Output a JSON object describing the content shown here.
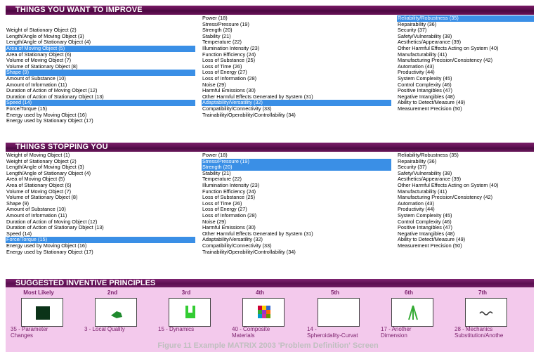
{
  "improve": {
    "title": "THINGS YOU WANT TO IMPROVE",
    "col1": [
      {
        "label": "",
        "sel": false
      },
      {
        "label": "",
        "sel": false
      },
      {
        "label": "Weight of Stationary Object (2)",
        "sel": false
      },
      {
        "label": "Length/Angle of Moving Object (3)",
        "sel": false
      },
      {
        "label": "Length/Angle of Stationary Object (4)",
        "sel": false
      },
      {
        "label": "Area of Moving Object (5)",
        "sel": true
      },
      {
        "label": "Area of Stationary Object (6)",
        "sel": false
      },
      {
        "label": "Volume of Moving Object (7)",
        "sel": false
      },
      {
        "label": "Volume of Stationary Object (8)",
        "sel": false
      },
      {
        "label": "Shape (9)",
        "sel": true
      },
      {
        "label": "Amount of Substance (10)",
        "sel": false
      },
      {
        "label": "Amount of Information (11)",
        "sel": false
      },
      {
        "label": "Duration of Action of Moving Object (12)",
        "sel": false
      },
      {
        "label": "Duration of Action of Stationary Object (13)",
        "sel": false
      },
      {
        "label": "Speed (14)",
        "sel": true
      },
      {
        "label": "Force/Torque (15)",
        "sel": false
      },
      {
        "label": "Energy used by Moving Object (16)",
        "sel": false
      },
      {
        "label": "Energy used by Stationary Object (17)",
        "sel": false
      }
    ],
    "col2": [
      {
        "label": "Power (18)",
        "sel": false
      },
      {
        "label": "Stress/Pressure (19)",
        "sel": false
      },
      {
        "label": "Strength (20)",
        "sel": false
      },
      {
        "label": "Stability (21)",
        "sel": false
      },
      {
        "label": "Temperature (22)",
        "sel": false
      },
      {
        "label": "Illumination Intensity (23)",
        "sel": false
      },
      {
        "label": "Function Efficiency (24)",
        "sel": false
      },
      {
        "label": "Loss of Substance (25)",
        "sel": false
      },
      {
        "label": "Loss of Time (26)",
        "sel": false
      },
      {
        "label": "Loss of Energy (27)",
        "sel": false
      },
      {
        "label": "Loss of Information (28)",
        "sel": false
      },
      {
        "label": "Noise (29)",
        "sel": false
      },
      {
        "label": "Harmful Emissions (30)",
        "sel": false
      },
      {
        "label": "Other Harmful Effects Generated by System (31)",
        "sel": false
      },
      {
        "label": "Adaptability/Versatility (32)",
        "sel": true
      },
      {
        "label": "Compatibility/Connectivity (33)",
        "sel": false
      },
      {
        "label": "Trainability/Operability/Controllability (34)",
        "sel": false
      }
    ],
    "col3": [
      {
        "label": "Reliability/Robustness (35)",
        "sel": true
      },
      {
        "label": "Repairability (36)",
        "sel": false
      },
      {
        "label": "Security (37)",
        "sel": false
      },
      {
        "label": "Safety/Vulnerability (38)",
        "sel": false
      },
      {
        "label": "Aesthetics/Appearance (39)",
        "sel": false
      },
      {
        "label": "Other Harmful Effects Acting on System (40)",
        "sel": false
      },
      {
        "label": "Manufacturability (41)",
        "sel": false
      },
      {
        "label": "Manufacturing Precision/Consistency (42)",
        "sel": false
      },
      {
        "label": "Automation (43)",
        "sel": false
      },
      {
        "label": "Productivity (44)",
        "sel": false
      },
      {
        "label": "System Complexity (45)",
        "sel": false
      },
      {
        "label": "Control Complexity (46)",
        "sel": false
      },
      {
        "label": "Positive Intangibles (47)",
        "sel": false
      },
      {
        "label": "Negative Intangibles (48)",
        "sel": false
      },
      {
        "label": "Ability to Detect/Measure (49)",
        "sel": false
      },
      {
        "label": "Measurement Precision (50)",
        "sel": false
      }
    ]
  },
  "stopping": {
    "title": "THINGS STOPPING YOU",
    "col1": [
      {
        "label": "Weight of Moving Object (1)",
        "sel": false
      },
      {
        "label": "Weight of Stationary Object (2)",
        "sel": false
      },
      {
        "label": "Length/Angle of Moving Object (3)",
        "sel": false
      },
      {
        "label": "Length/Angle of Stationary Object (4)",
        "sel": false
      },
      {
        "label": "Area of Moving Object (5)",
        "sel": false
      },
      {
        "label": "Area of Stationary Object (6)",
        "sel": false
      },
      {
        "label": "Volume of Moving Object (7)",
        "sel": false
      },
      {
        "label": "Volume of Stationary Object (8)",
        "sel": false
      },
      {
        "label": "Shape (9)",
        "sel": false
      },
      {
        "label": "Amount of Substance (10)",
        "sel": false
      },
      {
        "label": "Amount of Information (11)",
        "sel": false
      },
      {
        "label": "Duration of Action of Moving Object (12)",
        "sel": false
      },
      {
        "label": "Duration of Action of Stationary Object (13)",
        "sel": false
      },
      {
        "label": "Speed (14)",
        "sel": false
      },
      {
        "label": "Force/Torque (15)",
        "sel": true
      },
      {
        "label": "Energy used by Moving Object (16)",
        "sel": false
      },
      {
        "label": "Energy used by Stationary Object (17)",
        "sel": false
      }
    ],
    "col2": [
      {
        "label": "Power (18)",
        "sel": false
      },
      {
        "label": "Stress/Pressure (19)",
        "sel": true
      },
      {
        "label": "Strength (20)",
        "sel": true
      },
      {
        "label": "Stability (21)",
        "sel": false
      },
      {
        "label": "Temperature (22)",
        "sel": false
      },
      {
        "label": "Illumination Intensity (23)",
        "sel": false
      },
      {
        "label": "Function Efficiency (24)",
        "sel": false
      },
      {
        "label": "Loss of Substance (25)",
        "sel": false
      },
      {
        "label": "Loss of Time (26)",
        "sel": false
      },
      {
        "label": "Loss of Energy (27)",
        "sel": false
      },
      {
        "label": "Loss of Information (28)",
        "sel": false
      },
      {
        "label": "Noise (29)",
        "sel": false
      },
      {
        "label": "Harmful Emissions (30)",
        "sel": false
      },
      {
        "label": "Other Harmful Effects Generated by System (31)",
        "sel": false
      },
      {
        "label": "Adaptability/Versatility (32)",
        "sel": false
      },
      {
        "label": "Compatibility/Connectivity (33)",
        "sel": false
      },
      {
        "label": "Trainability/Operability/Controllability (34)",
        "sel": false
      }
    ],
    "col3": [
      {
        "label": "Reliability/Robustness (35)",
        "sel": false
      },
      {
        "label": "Repairability (36)",
        "sel": false
      },
      {
        "label": "Security (37)",
        "sel": false
      },
      {
        "label": "Safety/Vulnerability (38)",
        "sel": false
      },
      {
        "label": "Aesthetics/Appearance (39)",
        "sel": false
      },
      {
        "label": "Other Harmful Effects Acting on System (40)",
        "sel": false
      },
      {
        "label": "Manufacturability (41)",
        "sel": false
      },
      {
        "label": "Manufacturing Precision/Consistency (42)",
        "sel": false
      },
      {
        "label": "Automation (43)",
        "sel": false
      },
      {
        "label": "Productivity (44)",
        "sel": false
      },
      {
        "label": "System Complexity (45)",
        "sel": false
      },
      {
        "label": "Control Complexity (46)",
        "sel": false
      },
      {
        "label": "Positive Intangibles (47)",
        "sel": false
      },
      {
        "label": "Negative Intangibles (48)",
        "sel": false
      },
      {
        "label": "Ability to Detect/Measure (49)",
        "sel": false
      },
      {
        "label": "Measurement Precision (50)",
        "sel": false
      }
    ]
  },
  "principles": {
    "title": "SUGGESTED INVENTIVE PRINCIPLES",
    "items": [
      {
        "rank": "Most Likely",
        "name": "35 - Parameter\nChanges",
        "icon": "dark-square-icon"
      },
      {
        "rank": "2nd",
        "name": "3 - Local Quality",
        "icon": "green-blob-icon"
      },
      {
        "rank": "3rd",
        "name": "15 - Dynamics",
        "icon": "green-figure-icon"
      },
      {
        "rank": "4th",
        "name": "40 - Composite\nMaterials",
        "icon": "color-grid-icon"
      },
      {
        "rank": "5th",
        "name": "14 -\nSpheroidality-Curvat",
        "icon": "blank-icon"
      },
      {
        "rank": "6th",
        "name": "17 - Another\nDimension",
        "icon": "green-arrow-icon"
      },
      {
        "rank": "7th",
        "name": "28 - Mechanics\nSubstitution/Anothe",
        "icon": "wave-icon"
      }
    ]
  },
  "caption": "Figure 11 Example MATRIX 2003 'Problem Definition' Screen",
  "colors": {
    "selection": "#3a8fe6",
    "header": "#5a0d4c",
    "panel": "#f3c9ec",
    "accent": "#7a1f6b"
  }
}
